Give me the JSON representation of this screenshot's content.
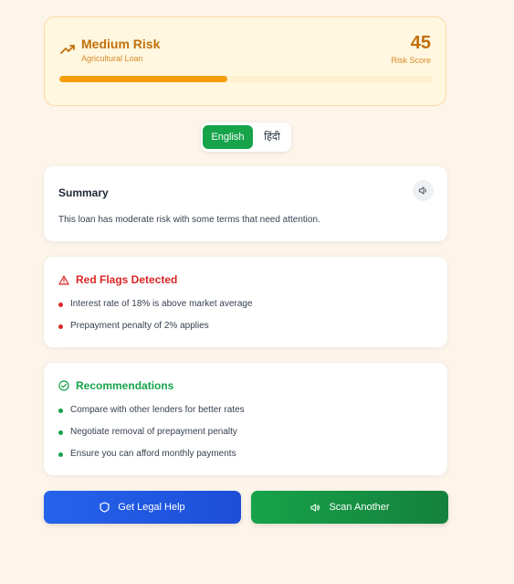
{
  "risk": {
    "level": "Medium Risk",
    "loan_type": "Agricultural Loan",
    "score": "45",
    "score_label": "Risk Score",
    "progress_percent": 45,
    "icon": "trending-up-icon",
    "accent_color": "#c2700a",
    "bar_color": "#f59e0b"
  },
  "language": {
    "options": [
      "English",
      "हिंदी"
    ],
    "selected": "English"
  },
  "summary": {
    "title": "Summary",
    "text": "This loan has moderate risk with some terms that need attention.",
    "icon": "speaker-icon"
  },
  "red_flags": {
    "title": "Red Flags Detected",
    "icon": "warning-triangle-icon",
    "items": [
      "Interest rate of 18% is above market average",
      "Prepayment penalty of 2% applies"
    ]
  },
  "recommendations": {
    "title": "Recommendations",
    "icon": "check-circle-icon",
    "items": [
      "Compare with other lenders for better rates",
      "Negotiate removal of prepayment penalty",
      "Ensure you can afford monthly payments"
    ]
  },
  "actions": {
    "legal_help": "Get Legal Help",
    "scan_another": "Scan Another"
  },
  "colors": {
    "red_flag": "#dc2626",
    "green": "#16a34a",
    "blue": "#2563eb"
  }
}
